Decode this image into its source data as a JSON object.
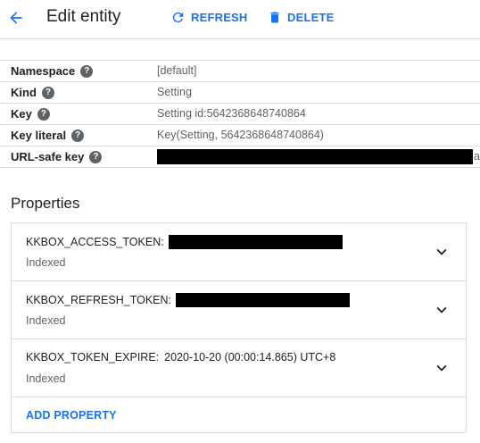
{
  "header": {
    "title": "Edit entity",
    "refresh_label": "REFRESH",
    "delete_label": "DELETE"
  },
  "key_info": [
    {
      "label": "Namespace",
      "value": "[default]"
    },
    {
      "label": "Kind",
      "value": "Setting"
    },
    {
      "label": "Key",
      "value": "Setting id:5642368648740864"
    },
    {
      "label": "Key literal",
      "value": "Key(Setting, 5642368648740864)"
    },
    {
      "label": "URL-safe key",
      "value": "",
      "tail": "a'"
    }
  ],
  "properties": {
    "title": "Properties",
    "items": [
      {
        "name": "KKBOX_ACCESS_TOKEN:",
        "value": "",
        "indexed": "Indexed"
      },
      {
        "name": "KKBOX_REFRESH_TOKEN:",
        "value": "",
        "indexed": "Indexed"
      },
      {
        "name": "KKBOX_TOKEN_EXPIRE:",
        "value": "2020-10-20 (00:00:14.865) UTC+8",
        "indexed": "Indexed"
      }
    ],
    "add_label": "ADD PROPERTY"
  },
  "colors": {
    "accent": "#1a73e8",
    "text": "#202124",
    "muted": "#5f6368",
    "divider": "#dadce0"
  },
  "icons": [
    "arrow-back-icon",
    "refresh-icon",
    "trash-icon",
    "help-icon",
    "chevron-down-icon"
  ]
}
